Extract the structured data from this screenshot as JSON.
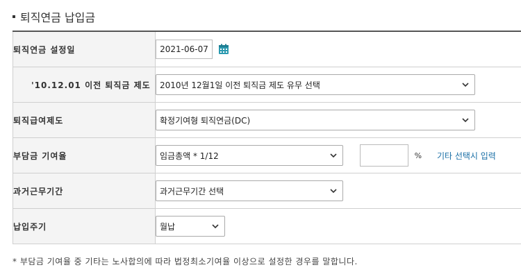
{
  "section": {
    "title": "퇴직연금 납입금"
  },
  "rows": {
    "date": {
      "label": "퇴직연금 설정일",
      "value": "2021-06-07",
      "icon": "calendar-icon"
    },
    "pre_system": {
      "label": "'10.12.01 이전 퇴직금 제도",
      "selected": "2010년 12월1일 이전 퇴직금 제도 유무 선택"
    },
    "benefit": {
      "label": "퇴직급여제도",
      "selected": "확정기여형 퇴직연금(DC)"
    },
    "contribution": {
      "label": "부담금 기여율",
      "selected": "임금총액 * 1/12",
      "input_value": "",
      "unit": "%",
      "hint": "기타 선택시 입력"
    },
    "past_service": {
      "label": "과거근무기간",
      "selected": "과거근무기간 선택"
    },
    "payment_cycle": {
      "label": "납입주기",
      "selected": "월납"
    }
  },
  "footnote": "* 부담금 기여율 중 기타는 노사합의에 따라 법정최소기여율 이상으로 설정한 경우를 말합니다.",
  "colors": {
    "accent": "#1a6fa6",
    "label_bg": "#f4f4f4",
    "border": "#cfcfcf",
    "calendar": "#2b9ab0"
  }
}
